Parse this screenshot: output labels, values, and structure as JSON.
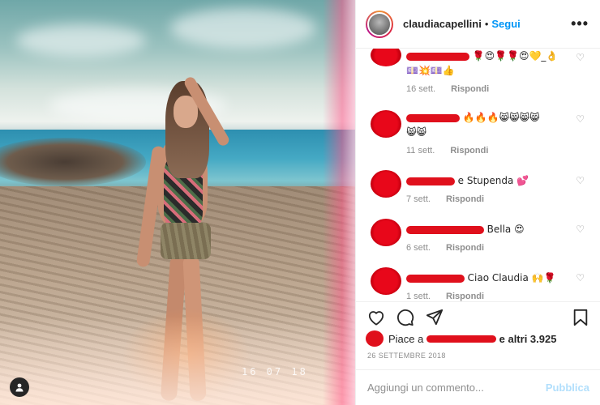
{
  "post": {
    "photo_date_stamp": "16 07 18",
    "username": "claudiacapellini",
    "separator": "•",
    "follow_label": "Segui",
    "more_label": "•••"
  },
  "comments": [
    {
      "text_suffix": "🌹😍🌹🌹😍💛_👌",
      "second_line": "💷💥💷👍",
      "time": "16 sett.",
      "reply": "Rispondi"
    },
    {
      "text_suffix": "🔥🔥🔥😸😸😸😸",
      "second_line": "😸😸",
      "time": "11 sett.",
      "reply": "Rispondi"
    },
    {
      "text_suffix": "e Stupenda 💕",
      "second_line": "",
      "time": "7 sett.",
      "reply": "Rispondi"
    },
    {
      "text_suffix": "Bella 😍",
      "second_line": "",
      "time": "6 sett.",
      "reply": "Rispondi"
    },
    {
      "text_suffix": "Ciao Claudia 🙌🌹",
      "second_line": "",
      "time": "1 sett.",
      "reply": "Rispondi"
    }
  ],
  "likes": {
    "prefix": "Piace a",
    "suffix": "e altri 3.925"
  },
  "post_date": "26 SETTEMBRE 2018",
  "add_comment": {
    "placeholder": "Aggiungi un commento...",
    "publish_label": "Pubblica"
  },
  "icons": {
    "like": "heart-icon",
    "comment": "comment-bubble-icon",
    "share": "paper-plane-icon",
    "save": "bookmark-icon",
    "user_tag": "user-tag-icon",
    "more": "more-options-icon"
  },
  "colors": {
    "follow": "#0095f6",
    "publish_disabled": "#b2dffc",
    "muted": "#8e8e8e",
    "redaction": "#e0101c"
  }
}
